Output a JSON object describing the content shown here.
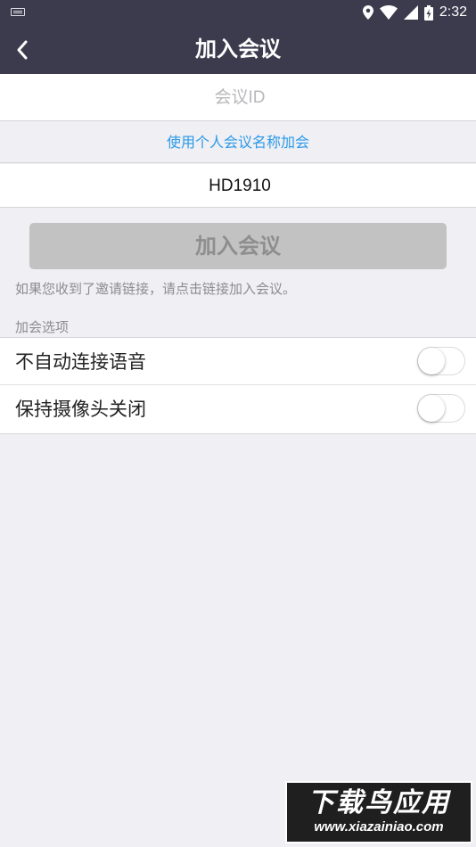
{
  "status_bar": {
    "time": "2:32"
  },
  "nav": {
    "title": "加入会议"
  },
  "form": {
    "meeting_id_placeholder": "会议ID",
    "meeting_id_value": "",
    "use_personal_name_link": "使用个人会议名称加会",
    "name_value": "HD1910",
    "join_button_label": "加入会议",
    "hint_text": "如果您收到了邀请链接，请点击链接加入会议。"
  },
  "options": {
    "section_label": "加会选项",
    "items": [
      {
        "label": "不自动连接语音",
        "enabled": false
      },
      {
        "label": "保持摄像头关闭",
        "enabled": false
      }
    ]
  },
  "watermark": {
    "title": "下载鸟应用",
    "url": "www.xiazainiao.com"
  },
  "colors": {
    "nav_background": "#3c3b4e",
    "link": "#2b9ae8",
    "button_disabled": "#c2c2c2",
    "page_background": "#efeff4"
  }
}
